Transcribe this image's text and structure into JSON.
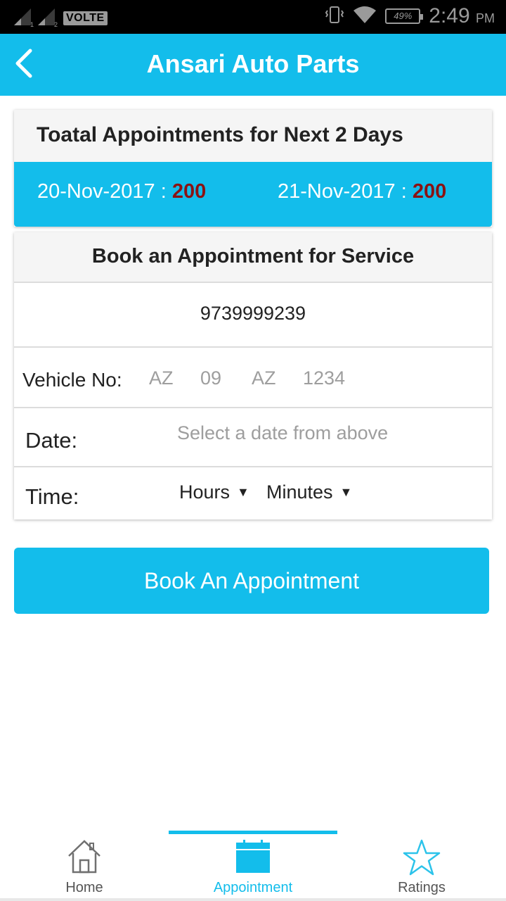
{
  "status_bar": {
    "sim1": "1",
    "sim2": "2",
    "network_label": "VOLTE",
    "battery": "49%",
    "time": "2:49",
    "ampm": "PM"
  },
  "header": {
    "title": "Ansari Auto Parts",
    "back_icon": "chevron-left-icon"
  },
  "appointments_summary": {
    "title": "Toatal Appointments for Next 2 Days",
    "days": [
      {
        "date": "20-Nov-2017",
        "separator": " : ",
        "count": "200"
      },
      {
        "date": "21-Nov-2017",
        "separator": " : ",
        "count": "200"
      }
    ]
  },
  "booking_form": {
    "title": "Book an Appointment for Service",
    "phone": "9739999239",
    "vehicle_label": "Vehicle No:",
    "vehicle_placeholders": [
      "AZ",
      "09",
      "AZ",
      "1234"
    ],
    "date_label": "Date:",
    "date_placeholder": "Select a date from above",
    "time_label": "Time:",
    "hours_label": "Hours",
    "minutes_label": "Minutes",
    "dropdown_caret": "▼"
  },
  "book_button": "Book An Appointment",
  "bottom_nav": [
    {
      "label": "Home",
      "icon": "home-icon",
      "active": false
    },
    {
      "label": "Appointment",
      "icon": "calendar-icon",
      "active": true
    },
    {
      "label": "Ratings",
      "icon": "star-icon",
      "active": false
    }
  ],
  "colors": {
    "accent": "#13bdeb",
    "count_highlight": "#8b1212",
    "status_bar": "#000000"
  }
}
